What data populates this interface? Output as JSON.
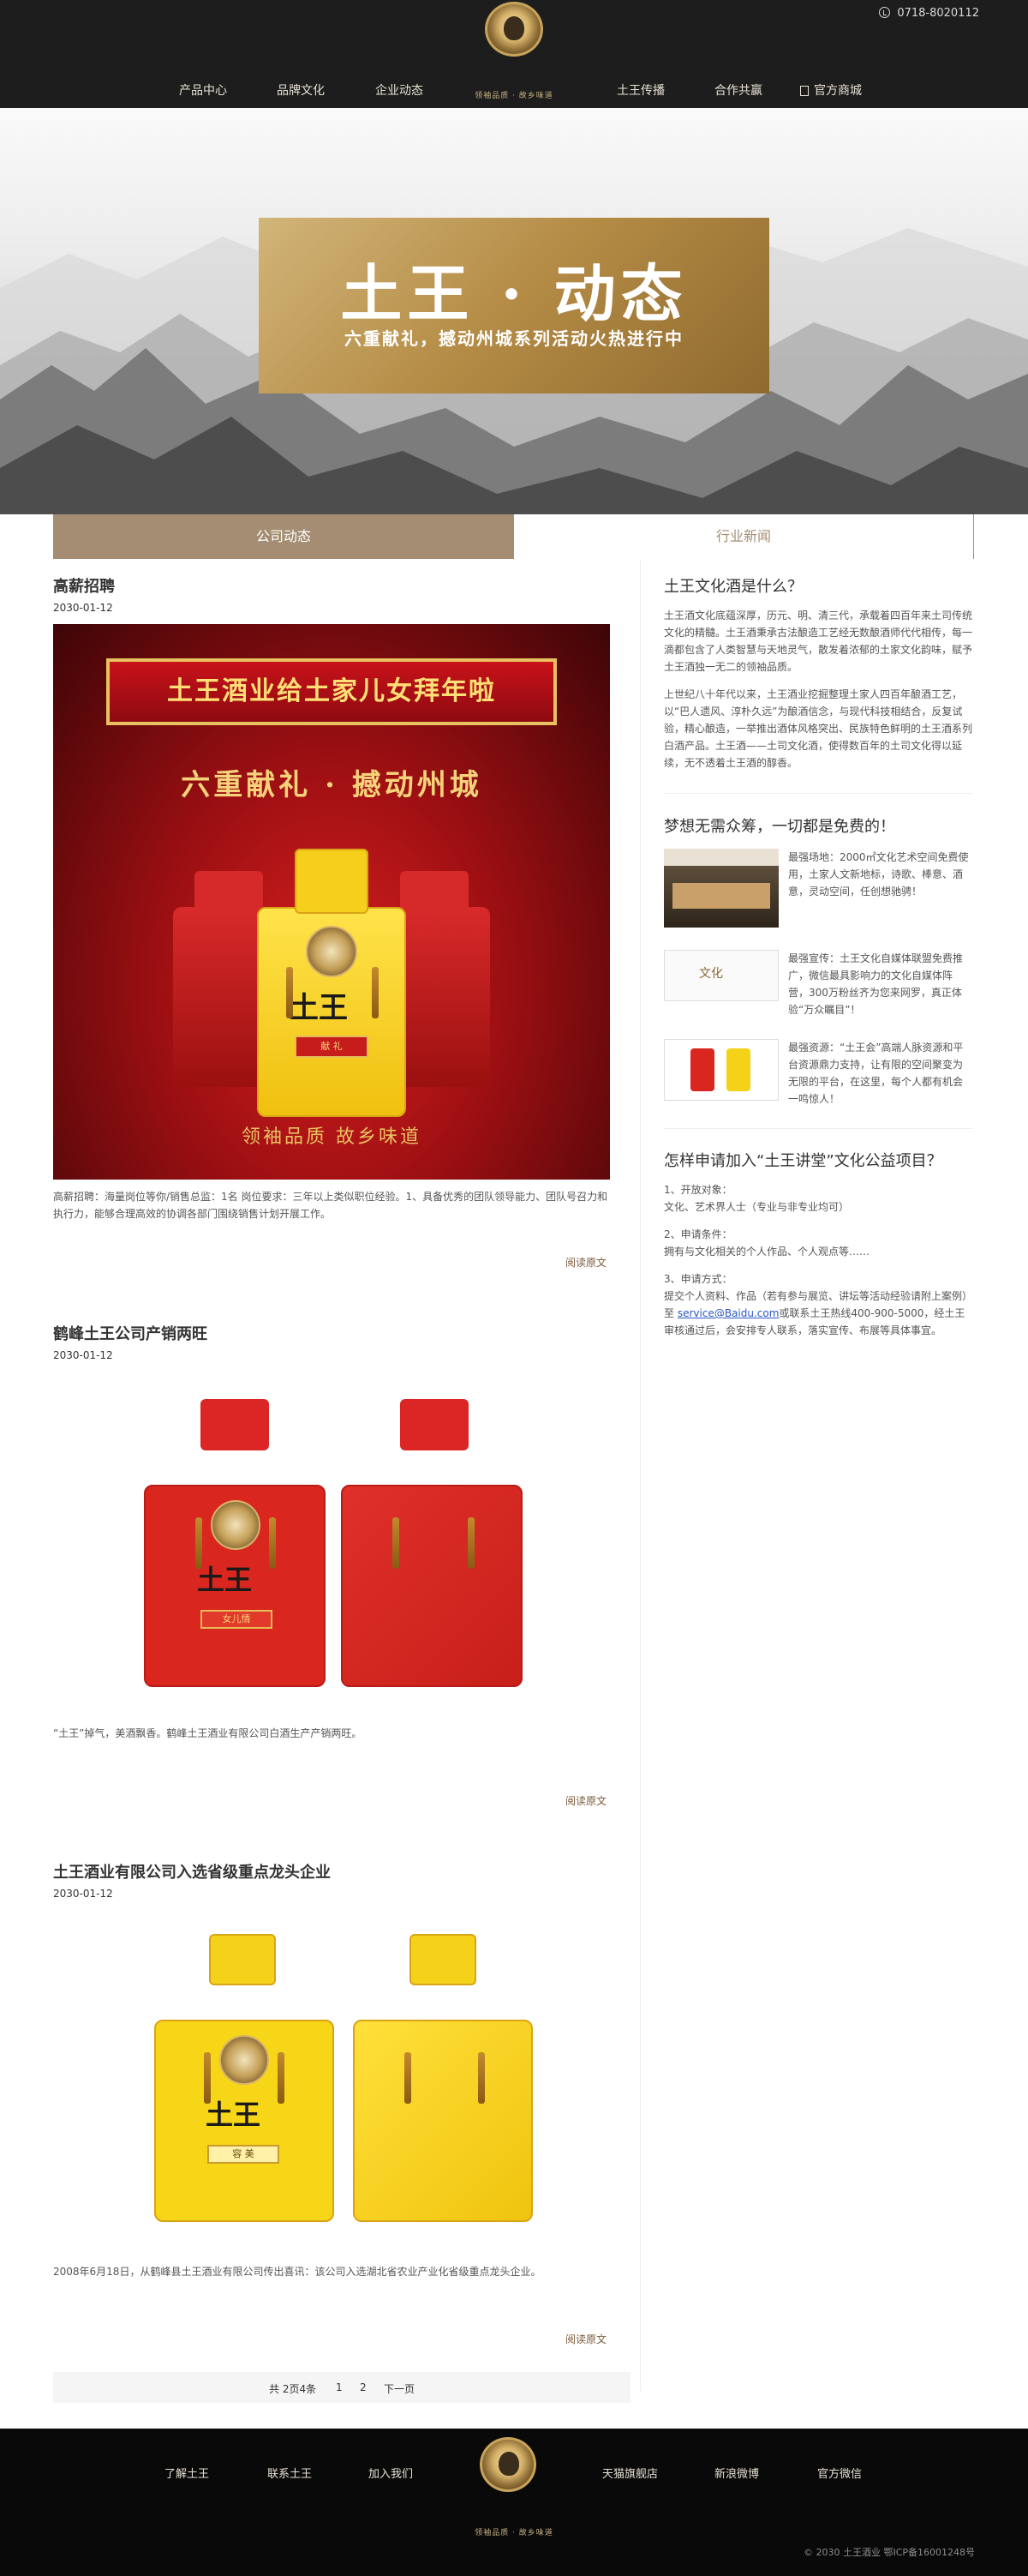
{
  "header": {
    "logo_slogan": "领袖品质 · 故乡味道",
    "phone": "0718-8020112",
    "nav": [
      "产品中心",
      "品牌文化",
      "企业动态",
      "土王传播",
      "合作共赢",
      "官方商城"
    ]
  },
  "banner": {
    "title": "土王 · 动态",
    "subtitle": "六重献礼，撼动州城系列活动火热进行中"
  },
  "tabs": [
    "公司动态",
    "行业新闻"
  ],
  "articles": [
    {
      "title": "高薪招聘",
      "date": "2030-01-12",
      "image": {
        "ribbon": "土王酒业给土家儿女拜年啦",
        "headline": "六重献礼 · 撼动州城",
        "bottle_char": "土王",
        "bottle_label": "献 礼",
        "footer": "领袖品质   故乡味道"
      },
      "summary": "高薪招聘：海量岗位等你/销售总监：1名 岗位要求：三年以上类似职位经验。1、具备优秀的团队领导能力、团队号召力和执行力，能够合理高效的协调各部门围绕销售计划开展工作。",
      "read_more": "阅读原文"
    },
    {
      "title": "鹤峰土王公司产销两旺",
      "date": "2030-01-12",
      "image": {
        "bottle_char": "土王",
        "bottle_label": "女儿情"
      },
      "summary": "“土王”掉气，美酒飘香。鹤峰土王酒业有限公司白酒生产产销两旺。",
      "read_more": "阅读原文"
    },
    {
      "title": "土王酒业有限公司入选省级重点龙头企业",
      "date": "2030-01-12",
      "image": {
        "bottle_char": "土王",
        "bottle_label": "容 美"
      },
      "summary": "2008年6月18日，从鹤峰县土王酒业有限公司传出喜讯：该公司入选湖北省农业产业化省级重点龙头企业。",
      "read_more": "阅读原文"
    }
  ],
  "pager": {
    "summary": "共 2页4条",
    "pages": [
      "1",
      "2"
    ],
    "next": "下一页"
  },
  "sidebar": {
    "culture": {
      "heading": "土王文化酒是什么？",
      "p1": "土王酒文化底蕴深厚，历元、明、清三代，承载着四百年来土司传统文化的精髓。土王酒秉承古法酿造工艺经无数酿酒师代代相传，每一滴都包含了人类智慧与天地灵气，散发着浓郁的土家文化韵味，赋予土王酒独一无二的领袖品质。",
      "p2": "上世纪八十年代以来，土王酒业挖掘整理土家人四百年酿酒工艺，以“巴人遗风、淳朴久远”为酿酒信念，与现代科技相结合，反复试验，精心酿造，一举推出酒体风格突出、民族特色鲜明的土王酒系列白酒产品。土王酒——土司文化酒，使得数百年的土司文化得以延续，无不透着土王酒的醇香。"
    },
    "free": {
      "heading": "梦想无需众筹，一切都是免费的！",
      "items": [
        {
          "text": "最强场地：2000㎡文化艺术空间免费使用，土家人文新地标，诗歌、棒意、酒意，灵动空间，任创想驰骋！",
          "thumb_word": ""
        },
        {
          "text": "最强宣传：土王文化自媒体联盟免费推广，微信最具影响力的文化自媒体阵营，300万粉丝齐为您来网罗，真正体验“万众瞩目”！",
          "thumb_word": "文化"
        },
        {
          "text": "最强资源：“土王会”高端人脉资源和平台资源鼎力支持，让有限的空间聚变为无限的平台，在这里，每个人都有机会一鸣惊人！",
          "thumb_word": ""
        }
      ]
    },
    "join": {
      "heading": "怎样申请加入“土王讲堂”文化公益项目？",
      "l1": "1、开放对象：",
      "l1b": "文化、艺术界人士（专业与非专业均可）",
      "l2": "2、申请条件：",
      "l2b": "拥有与文化相关的个人作品、个人观点等……",
      "l3": "3、申请方式：",
      "l3b_pre": "提交个人资料、作品（若有参与展览、讲坛等活动经验请附上案例）至 ",
      "email": "service@Baidu.com",
      "l3b_post": "或联系土王热线400-900-5000，经土王审核通过后，会安排专人联系，落实宣传、布展等具体事宜。"
    }
  },
  "footer": {
    "links": [
      "了解土王",
      "联系土王",
      "加入我们",
      "天猫旗舰店",
      "新浪微博",
      "官方微信"
    ],
    "slogan": "领袖品质 · 故乡味道",
    "copyright": "© 2030 土王酒业 鄂ICP备16001248号"
  },
  "colors": {
    "header_bg": "#1d1d1d",
    "accent_brown": "#a48d72",
    "gold": "#b48b45",
    "red": "#c61c1c",
    "yellow": "#f5d21a",
    "footer_bg": "#090909"
  }
}
